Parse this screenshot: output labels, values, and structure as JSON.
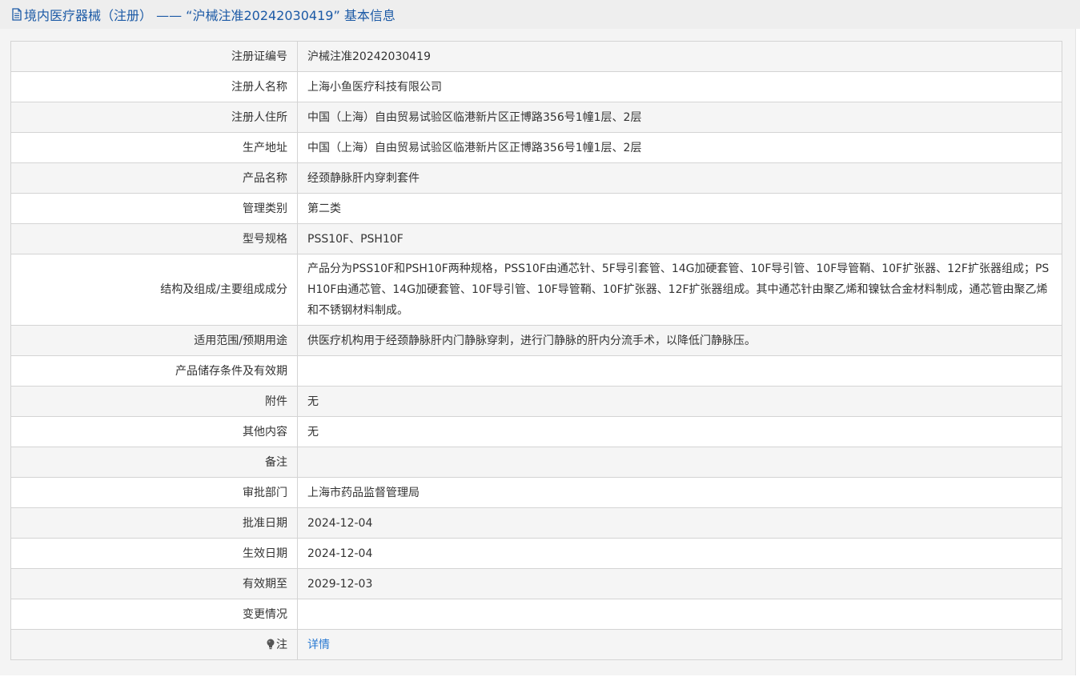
{
  "header": {
    "icon": "document-icon",
    "title": "境内医疗器械（注册） ——  “沪械注准20242030419”  基本信息"
  },
  "rows": [
    {
      "label": "注册证编号",
      "value": "沪械注准20242030419"
    },
    {
      "label": "注册人名称",
      "value": "上海小鱼医疗科技有限公司"
    },
    {
      "label": "注册人住所",
      "value": "中国（上海）自由贸易试验区临港新片区正博路356号1幢1层、2层"
    },
    {
      "label": "生产地址",
      "value": "中国（上海）自由贸易试验区临港新片区正博路356号1幢1层、2层"
    },
    {
      "label": "产品名称",
      "value": "经颈静脉肝内穿刺套件"
    },
    {
      "label": "管理类别",
      "value": "第二类"
    },
    {
      "label": "型号规格",
      "value": "PSS10F、PSH10F"
    },
    {
      "label": "结构及组成/主要组成成分",
      "value": "产品分为PSS10F和PSH10F两种规格，PSS10F由通芯针、5F导引套管、14G加硬套管、10F导引管、10F导管鞘、10F扩张器、12F扩张器组成；PSH10F由通芯管、14G加硬套管、10F导引管、10F导管鞘、10F扩张器、12F扩张器组成。其中通芯针由聚乙烯和镍钛合金材料制成，通芯管由聚乙烯和不锈钢材料制成。"
    },
    {
      "label": "适用范围/预期用途",
      "value": "供医疗机构用于经颈静脉肝内门静脉穿刺，进行门静脉的肝内分流手术，以降低门静脉压。"
    },
    {
      "label": "产品储存条件及有效期",
      "value": ""
    },
    {
      "label": "附件",
      "value": "无"
    },
    {
      "label": "其他内容",
      "value": "无"
    },
    {
      "label": "备注",
      "value": ""
    },
    {
      "label": "审批部门",
      "value": "上海市药品监督管理局"
    },
    {
      "label": "批准日期",
      "value": "2024-12-04"
    },
    {
      "label": "生效日期",
      "value": "2024-12-04"
    },
    {
      "label": "有效期至",
      "value": "2029-12-03"
    },
    {
      "label": "变更情况",
      "value": ""
    }
  ],
  "note": {
    "icon": "lightbulb-icon",
    "label": "注",
    "link_text": "详情"
  },
  "colors": {
    "header_text": "#1c5aa6",
    "link": "#2a7ad2",
    "border": "#d4d4d4",
    "row_alt": "#f5f5f5"
  }
}
